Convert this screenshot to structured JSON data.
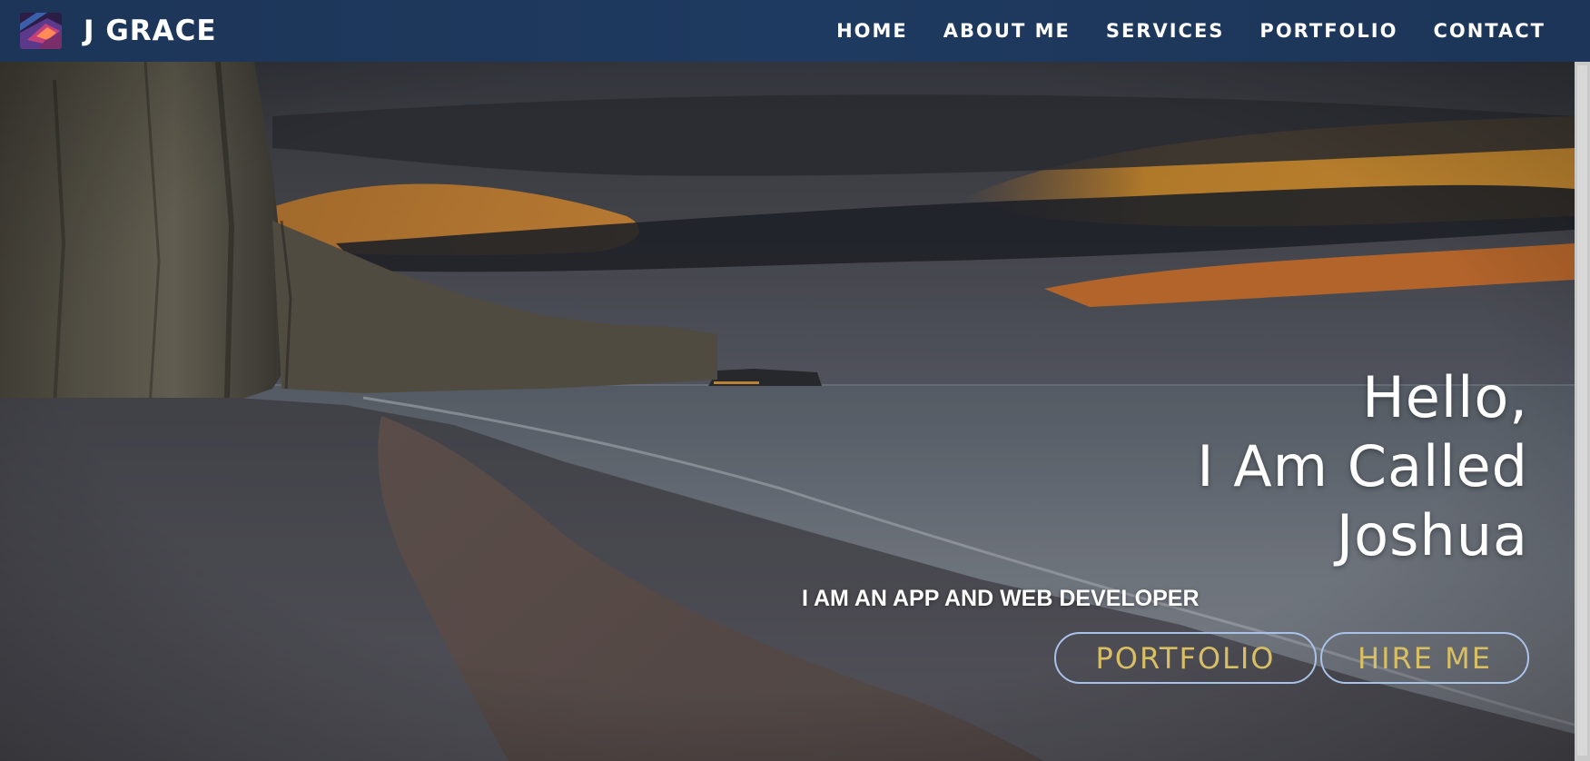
{
  "brand": {
    "name": "J GRACE",
    "logo_icon": "abstract-logo-icon"
  },
  "nav": {
    "items": [
      {
        "label": "HOME"
      },
      {
        "label": "ABOUT ME"
      },
      {
        "label": "SERVICES"
      },
      {
        "label": "PORTFOLIO"
      },
      {
        "label": "CONTACT"
      }
    ]
  },
  "hero": {
    "greeting_lines": [
      "Hello,",
      "I Am Called",
      "Joshua"
    ],
    "tagline": "I AM AN APP AND WEB DEVELOPER",
    "buttons": {
      "portfolio": "PORTFOLIO",
      "hire": "HIRE ME"
    }
  },
  "colors": {
    "navbar": "#1e3658",
    "button_text": "#d9bf63",
    "button_border": "#a9c2e8",
    "text": "#ffffff"
  }
}
